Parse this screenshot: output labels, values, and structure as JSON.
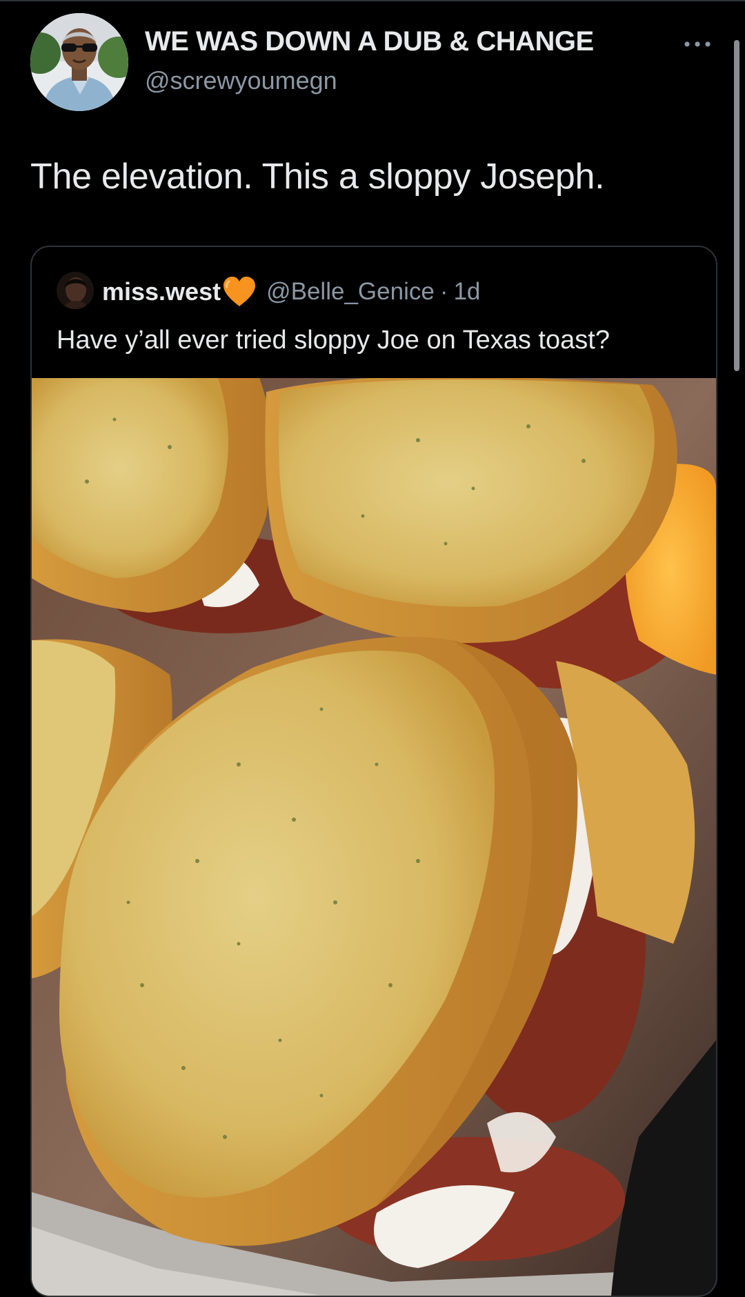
{
  "tweet": {
    "display_name": "WE WAS DOWN A DUB & CHANGE",
    "handle": "@screwyoumegn",
    "text": "The elevation. This a sloppy Joseph.",
    "more_icon": "more-horizontal-icon"
  },
  "quoted_tweet": {
    "display_name": "miss.west",
    "name_emoji": "orange-heart-icon",
    "handle": "@Belle_Genice",
    "separator": "·",
    "time": "1d",
    "text": "Have y’all ever tried sloppy Joe on Texas toast?"
  },
  "colors": {
    "background": "#000000",
    "primary_text": "#e7e9ea",
    "secondary_text": "#8b98a5",
    "border": "#2f3336",
    "heart": "#f7931e"
  }
}
